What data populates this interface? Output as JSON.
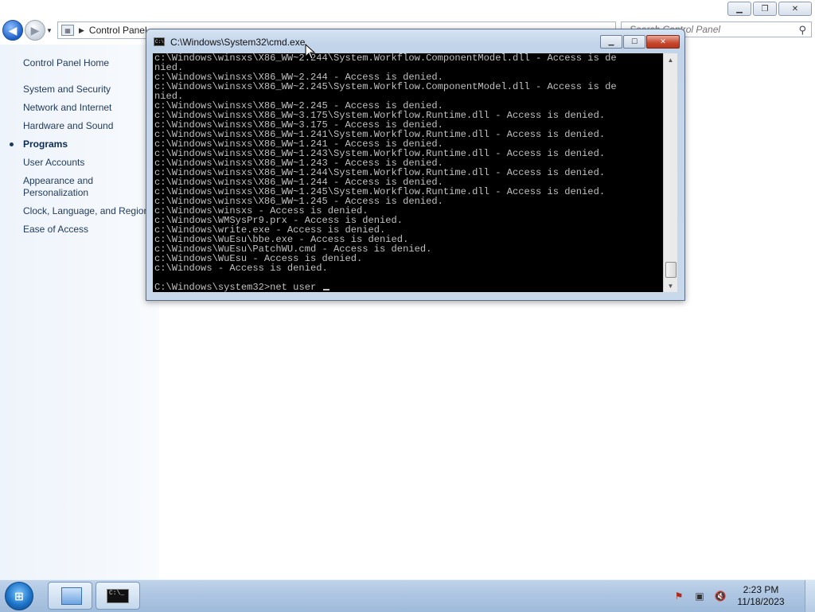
{
  "control_panel": {
    "address_path": "Control Panel",
    "search_placeholder": "Search Control Panel",
    "sidebar": {
      "home": "Control Panel Home",
      "items": [
        {
          "label": "System and Security"
        },
        {
          "label": "Network and Internet"
        },
        {
          "label": "Hardware and Sound"
        },
        {
          "label": "Programs"
        },
        {
          "label": "User Accounts"
        },
        {
          "label": "Appearance and\nPersonalization"
        },
        {
          "label": "Clock, Language, and Region"
        },
        {
          "label": "Ease of Access"
        }
      ],
      "active_item": "Programs"
    }
  },
  "cmd_window": {
    "title": "C:\\Windows\\System32\\cmd.exe",
    "output_lines": [
      "c:\\Windows\\winsxs\\X86_WW~2.244\\System.Workflow.ComponentModel.dll - Access is de",
      "nied.",
      "c:\\Windows\\winsxs\\X86_WW~2.244 - Access is denied.",
      "c:\\Windows\\winsxs\\X86_WW~2.245\\System.Workflow.ComponentModel.dll - Access is de",
      "nied.",
      "c:\\Windows\\winsxs\\X86_WW~2.245 - Access is denied.",
      "c:\\Windows\\winsxs\\X86_WW~3.175\\System.Workflow.Runtime.dll - Access is denied.",
      "c:\\Windows\\winsxs\\X86_WW~3.175 - Access is denied.",
      "c:\\Windows\\winsxs\\X86_WW~1.241\\System.Workflow.Runtime.dll - Access is denied.",
      "c:\\Windows\\winsxs\\X86_WW~1.241 - Access is denied.",
      "c:\\Windows\\winsxs\\X86_WW~1.243\\System.Workflow.Runtime.dll - Access is denied.",
      "c:\\Windows\\winsxs\\X86_WW~1.243 - Access is denied.",
      "c:\\Windows\\winsxs\\X86_WW~1.244\\System.Workflow.Runtime.dll - Access is denied.",
      "c:\\Windows\\winsxs\\X86_WW~1.244 - Access is denied.",
      "c:\\Windows\\winsxs\\X86_WW~1.245\\System.Workflow.Runtime.dll - Access is denied.",
      "c:\\Windows\\winsxs\\X86_WW~1.245 - Access is denied.",
      "c:\\Windows\\winsxs - Access is denied.",
      "c:\\Windows\\WMSysPr9.prx - Access is denied.",
      "c:\\Windows\\write.exe - Access is denied.",
      "c:\\Windows\\WuEsu\\bbe.exe - Access is denied.",
      "c:\\Windows\\WuEsu\\PatchWU.cmd - Access is denied.",
      "c:\\Windows\\WuEsu - Access is denied.",
      "c:\\Windows - Access is denied.",
      ""
    ],
    "prompt": "C:\\Windows\\system32>",
    "typed_command": "net user "
  },
  "taskbar": {
    "clock_time": "2:23 PM",
    "clock_date": "11/18/2023"
  },
  "colors": {
    "accent": "#1e395b",
    "console_bg": "#000000",
    "console_fg": "#c0c0c0",
    "taskbar": "#aec6e2"
  }
}
